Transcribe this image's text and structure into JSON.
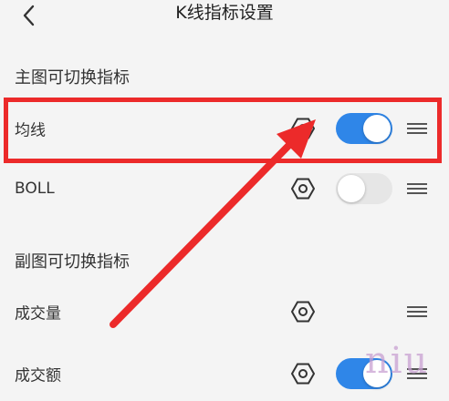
{
  "header": {
    "title": "K线指标设置",
    "back_icon": "chevron-left-icon"
  },
  "sections": [
    {
      "title": "主图可切换指标"
    },
    {
      "title": "副图可切换指标"
    }
  ],
  "rows": [
    {
      "label": "均线",
      "toggle": "on"
    },
    {
      "label": "BOLL",
      "toggle": "off"
    },
    {
      "label": "成交量",
      "toggle": "none"
    },
    {
      "label": "成交额",
      "toggle": "on"
    }
  ],
  "icons": {
    "settings": "hexagon-nut-icon",
    "drag": "drag-handle-icon"
  },
  "colors": {
    "toggle_on": "#2f86e8",
    "toggle_off": "#e6e6e6",
    "annotation_red": "#ec2a2a"
  },
  "watermark": "niu"
}
